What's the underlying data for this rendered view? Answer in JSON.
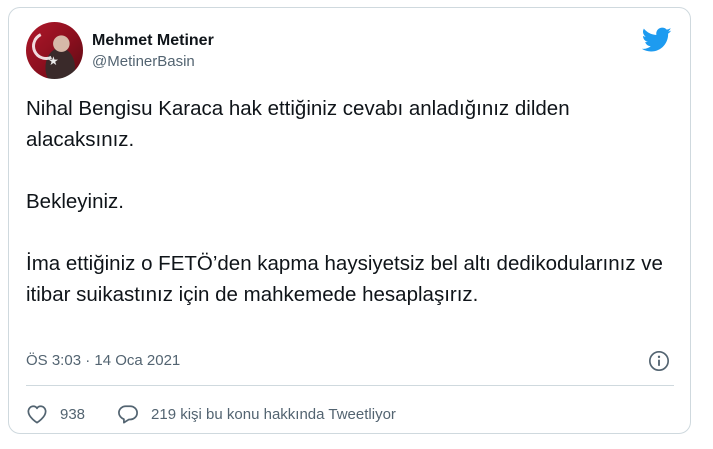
{
  "author": {
    "display_name": "Mehmet Metiner",
    "handle": "@MetinerBasin"
  },
  "tweet": {
    "text": "Nihal Bengisu Karaca hak ettiğiniz cevabı anladığınız dilden alacaksınız.\n\nBekleyiniz.\n\nİma ettiğiniz o FETÖ’den kapma haysiyetsiz bel altı dedikodularınız ve itibar suikastınız için de mahkemede hesaplaşırız.",
    "timestamp": "ÖS 3:03 · 14 Oca 2021"
  },
  "engagement": {
    "likes": "938",
    "conversation": "219 kişi bu konu hakkında Tweetliyor"
  },
  "colors": {
    "brand": "#1d9bf0",
    "text": "#0f1419",
    "muted": "#536471",
    "border": "#cfd9de"
  },
  "icons": {
    "brand": "twitter-bird-icon",
    "info": "info-icon",
    "like": "heart-icon",
    "reply": "comment-bubble-icon"
  }
}
